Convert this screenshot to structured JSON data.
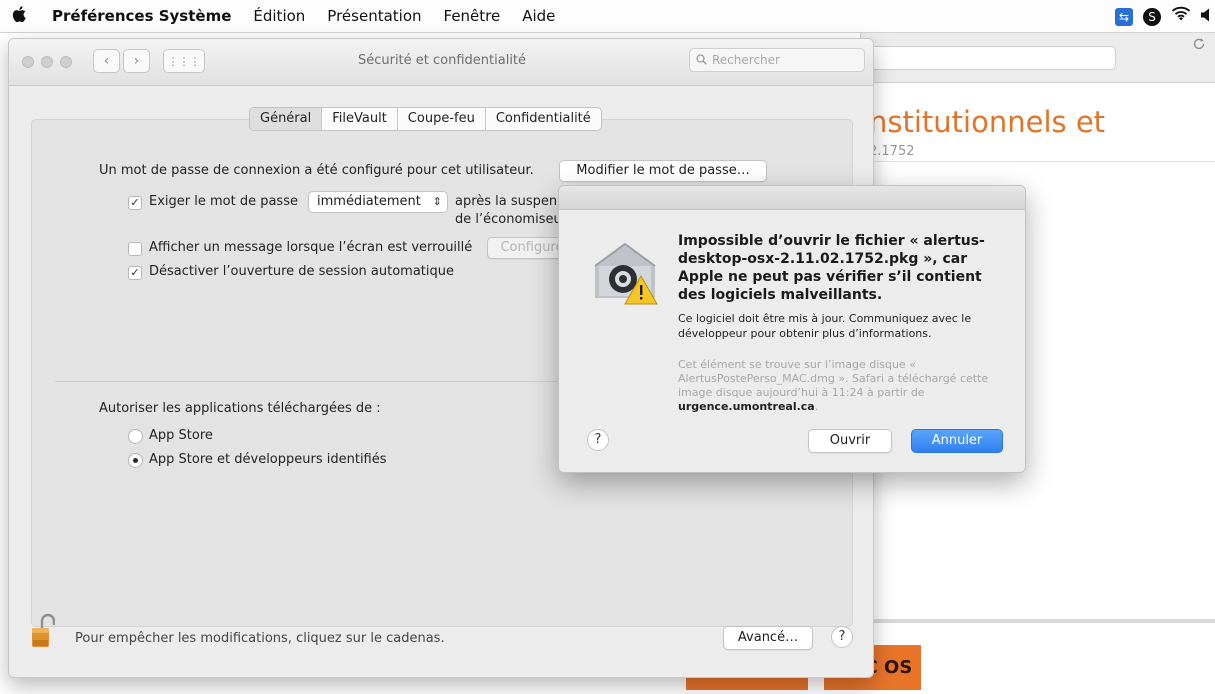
{
  "menubar": {
    "apple_icon": "apple-icon",
    "app_name": "Préférences Système",
    "items": [
      "Édition",
      "Présentation",
      "Fenêtre",
      "Aide"
    ],
    "status_icons": [
      "teamviewer-icon",
      "skype-icon",
      "wifi-icon",
      "volume-icon"
    ]
  },
  "browser": {
    "heading": "nstitutionnels et",
    "subtext": "2.1752",
    "download_buttons": [
      "MAC OS"
    ],
    "accent": "#e8742a"
  },
  "prefs": {
    "title": "Sécurité et confidentialité",
    "search_placeholder": "Rechercher",
    "tabs": [
      "Général",
      "FileVault",
      "Coupe-feu",
      "Confidentialité"
    ],
    "password_text": "Un mot de passe de connexion a été configuré pour cet utilisateur.",
    "change_password_button": "Modifier le mot de passe…",
    "require_password_label": "Exiger le mot de passe",
    "require_password_checked": true,
    "require_delay_value": "immédiatement",
    "require_after_line1": "après la suspen",
    "require_after_line2": "de l’économiseu",
    "show_message_label": "Afficher un message lorsque l’écran est verrouillé",
    "show_message_checked": false,
    "configure_button": "Configure",
    "disable_autologin_label": "Désactiver l’ouverture de session automatique",
    "disable_autologin_checked": true,
    "allow_apps_label": "Autoriser les applications téléchargées de :",
    "radio_options": [
      "App Store",
      "App Store et développeurs identifiés"
    ],
    "selected_radio": "App Store et développeurs identifiés",
    "lock_text": "Pour empêcher les modifications, cliquez sur le cadenas.",
    "advanced_button": "Avancé…",
    "help_label": "?"
  },
  "dialog": {
    "heading": "Impossible d’ouvrir le fichier « alertus-desktop-osx-2.11.02.1752.pkg », car Apple ne peut pas vérifier s’il contient des logiciels malveillants.",
    "body": "Ce logiciel doit être mis à jour. Communiquez avec le développeur pour obtenir plus d’informations.",
    "source_text": "Cet élément se trouve sur l’image disque « AlertusPostePerso_MAC.dmg ». Safari a téléchargé cette image disque aujourd’hui à 11:24 à partir de",
    "source_domain": "urgence.umontreal.ca",
    "source_suffix": ".",
    "open_button": "Ouvrir",
    "cancel_button": "Annuler",
    "help_label": "?",
    "icon": "gatekeeper-warning-icon",
    "accent": "#2f7ff0"
  }
}
